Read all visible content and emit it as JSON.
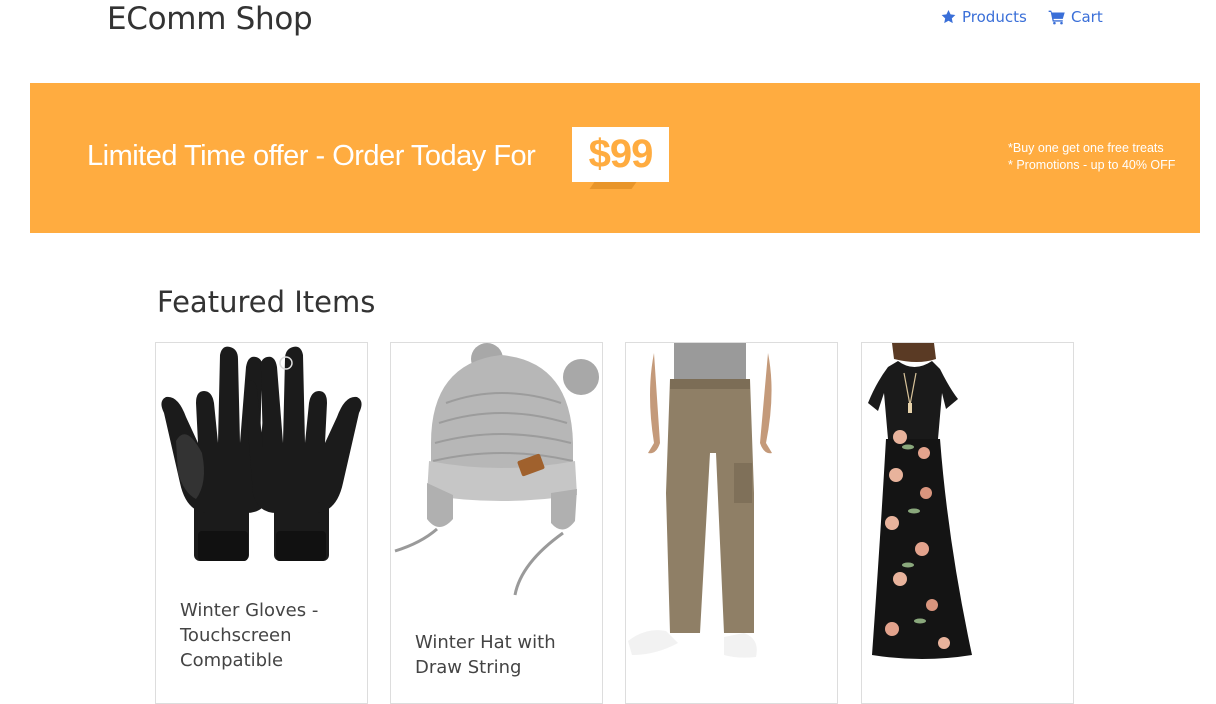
{
  "header": {
    "brand": "EComm Shop",
    "nav": [
      {
        "label": "Products",
        "icon": "star-icon"
      },
      {
        "label": "Cart",
        "icon": "cart-icon"
      }
    ]
  },
  "banner": {
    "text": "Limited Time offer - Order Today For",
    "price": "$99",
    "promos": [
      "*Buy one get one free treats",
      "* Promotions - up to 40% OFF"
    ],
    "color": "#ffac40"
  },
  "featured": {
    "title": "Featured Items",
    "items": [
      {
        "title": "Winter Gloves - Touchscreen Compatible"
      },
      {
        "title": "Winter Hat with Draw String"
      },
      {
        "title": ""
      },
      {
        "title": ""
      }
    ]
  },
  "colors": {
    "link": "#3a6fd8",
    "banner": "#ffac40"
  }
}
